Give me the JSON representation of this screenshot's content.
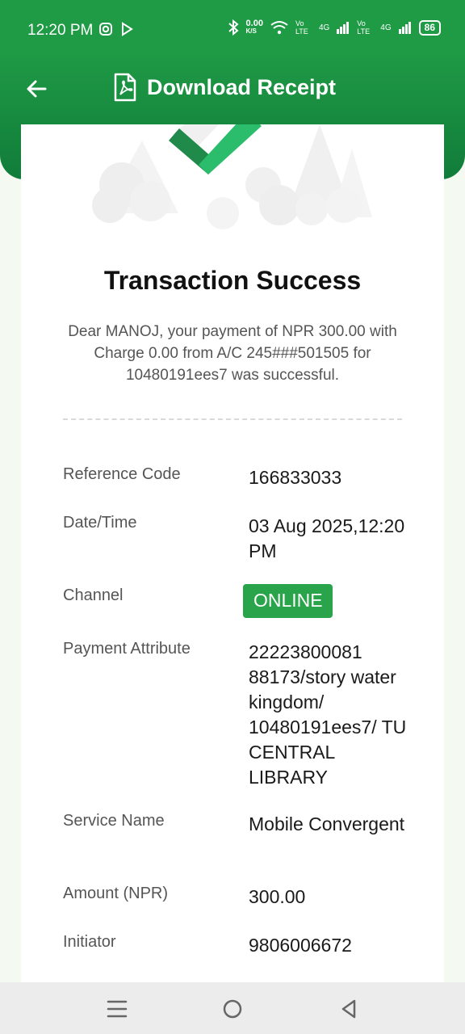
{
  "status_bar": {
    "time": "12:20 PM",
    "speed": "0.00",
    "speed_unit": "K/S",
    "net1": "Vo LTE",
    "net2": "4G",
    "battery": "86"
  },
  "header": {
    "title": "Download Receipt"
  },
  "receipt": {
    "title": "Transaction Success",
    "message": "Dear MANOJ, your payment of NPR 300.00 with Charge 0.00 from A/C 245###501505 for 10480191ees7 was successful.",
    "rows": [
      {
        "label": "Reference Code",
        "value": "166833033"
      },
      {
        "label": "Date/Time",
        "value": "03 Aug 2025,12:20 PM"
      },
      {
        "label": "Channel",
        "value": "ONLINE"
      },
      {
        "label": "Payment Attribute",
        "value": "22223800081 88173/story water kingdom/ 10480191ees7/ TU CENTRAL LIBRARY"
      },
      {
        "label": "Service Name",
        "value": "Mobile Convergent"
      },
      {
        "label": "Amount (NPR)",
        "value": "300.00"
      },
      {
        "label": "Initiator",
        "value": "9806006672"
      }
    ]
  },
  "colors": {
    "primary": "#1f9a45",
    "badge": "#2aa44a"
  },
  "icons": [
    "instagram-icon",
    "play-icon",
    "bluetooth-icon",
    "wifi-icon",
    "signal-icon",
    "battery-icon",
    "back-arrow-icon",
    "pdf-icon",
    "checkmark-icon",
    "menu-icon",
    "home-icon",
    "back-icon"
  ]
}
